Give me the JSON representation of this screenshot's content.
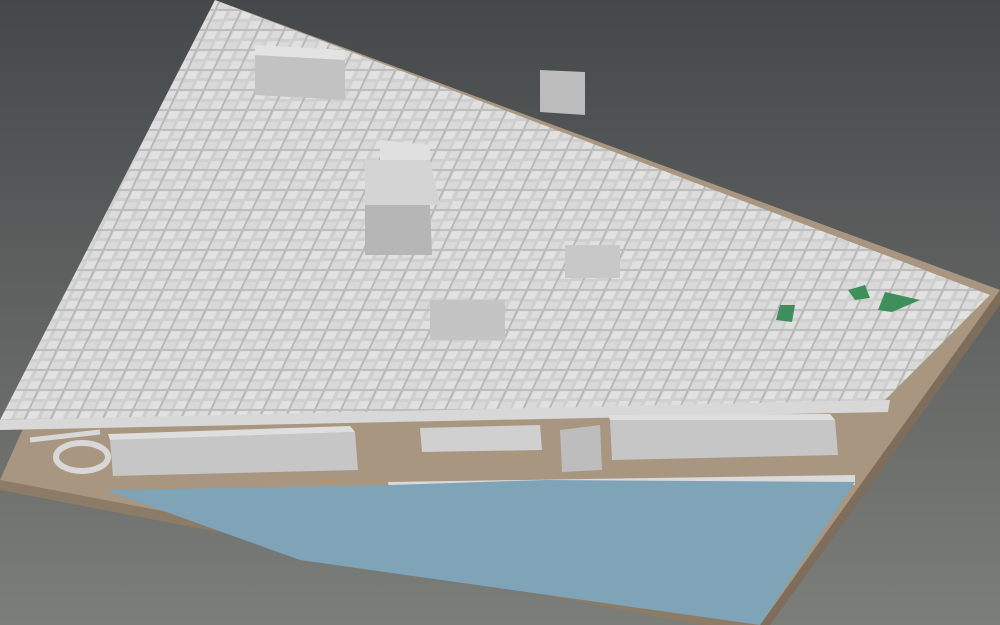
{
  "scene": {
    "kind": "3D city block model viewed at an oblique angle",
    "colors": {
      "background_top": "#46494a",
      "background_bottom": "#7a7d78",
      "ground": "#a89680",
      "ground_side": "#8c7b66",
      "building_top": "#d6d6d6",
      "building_side": "#b4b4b4",
      "building_dark": "#9d9d9d",
      "street": "#cfcfcf",
      "water": "#7fa3b7",
      "park": "#3f8f5c"
    },
    "features": [
      {
        "name": "cathedral-block",
        "type": "landmark"
      },
      {
        "name": "harbour-water",
        "type": "water"
      },
      {
        "name": "waterfront-warehouses",
        "type": "building-row"
      },
      {
        "name": "coastal-avenue",
        "type": "road"
      },
      {
        "name": "roundabout",
        "type": "road"
      },
      {
        "name": "green-park-patches",
        "type": "park"
      }
    ]
  }
}
